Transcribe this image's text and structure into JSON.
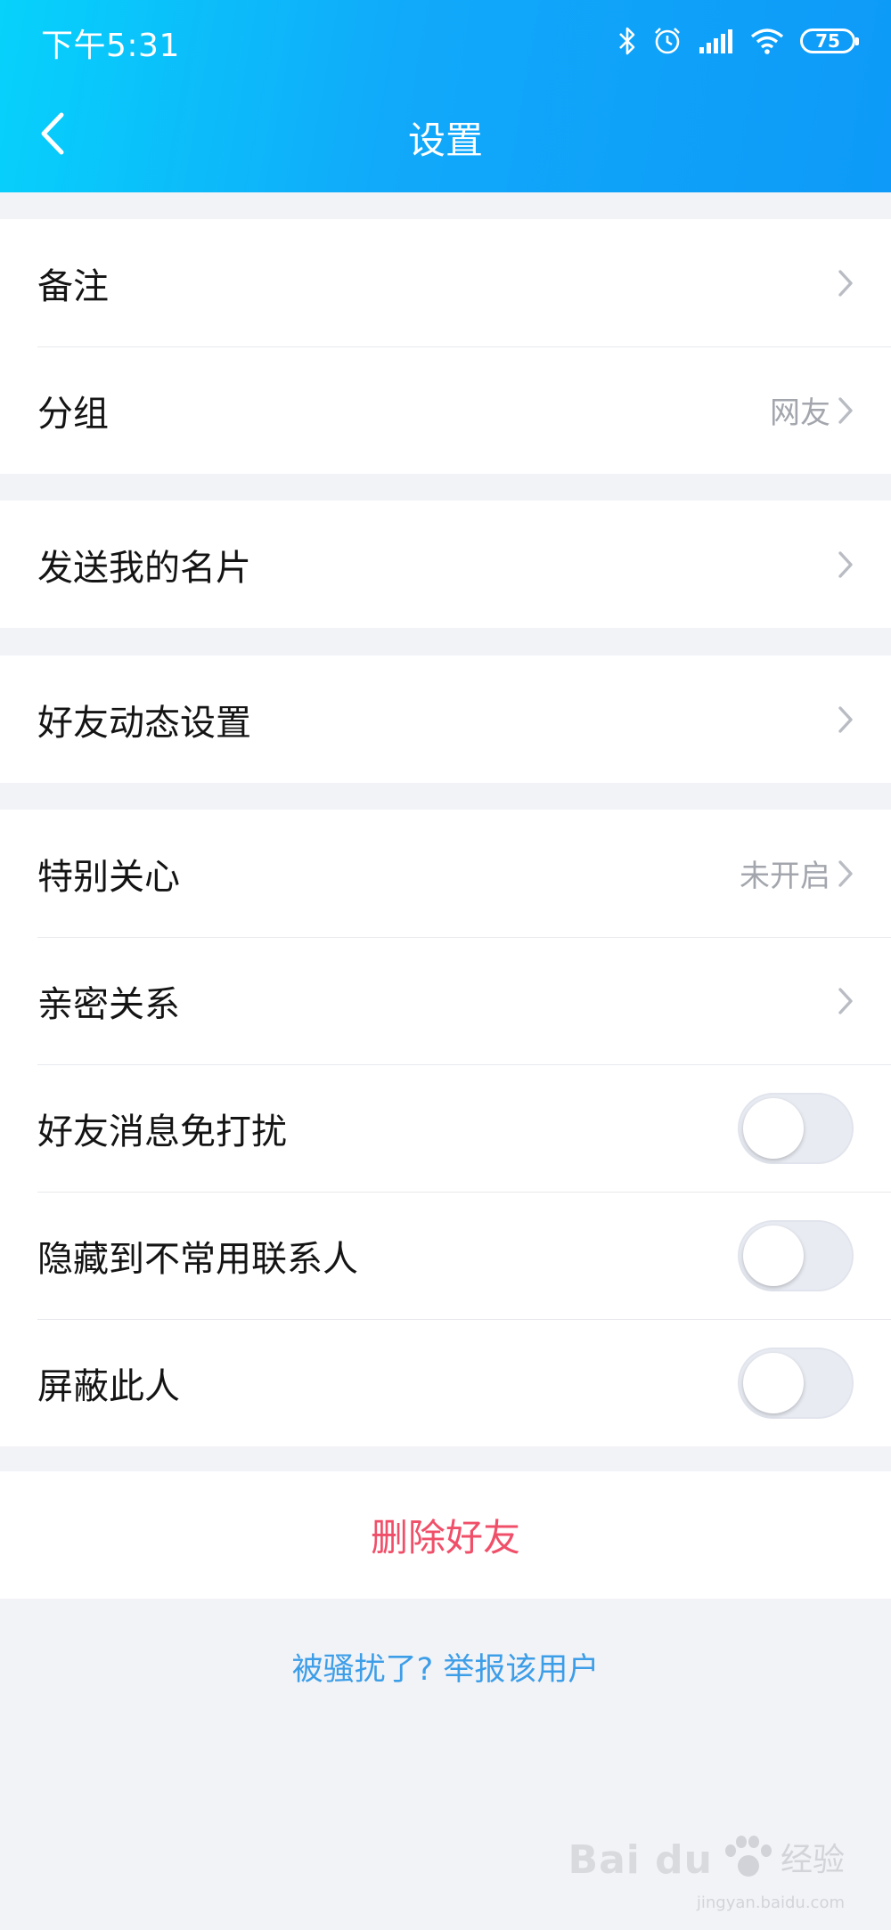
{
  "status_bar": {
    "time": "下午5:31",
    "battery": "75"
  },
  "nav": {
    "title": "设置",
    "back_icon": "chevron-left-icon"
  },
  "groups": [
    {
      "items": [
        {
          "label": "备注",
          "value": ""
        },
        {
          "label": "分组",
          "value": "网友"
        }
      ]
    },
    {
      "items": [
        {
          "label": "发送我的名片",
          "value": ""
        }
      ]
    },
    {
      "items": [
        {
          "label": "好友动态设置",
          "value": ""
        }
      ]
    },
    {
      "items": [
        {
          "label": "特别关心",
          "value": "未开启"
        },
        {
          "label": "亲密关系",
          "value": ""
        },
        {
          "label": "好友消息免打扰",
          "toggle": false
        },
        {
          "label": "隐藏到不常用联系人",
          "toggle": false
        },
        {
          "label": "屏蔽此人",
          "toggle": false
        }
      ]
    }
  ],
  "delete_button": {
    "label": "删除好友"
  },
  "report_link": {
    "label": "被骚扰了? 举报该用户"
  },
  "watermark": {
    "brand": "Bai du",
    "cn": "经验",
    "sub": "jingyan.baidu.com"
  },
  "colors": {
    "header_start": "#06d2fb",
    "header_end": "#0d9af8",
    "danger": "#f04f69",
    "link": "#3d9ee8",
    "background": "#f2f3f7"
  }
}
